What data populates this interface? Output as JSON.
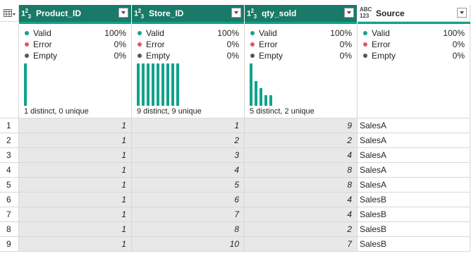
{
  "columns": [
    {
      "name": "Product_ID",
      "type_icon": "1²3",
      "profile": {
        "valid_label": "Valid",
        "valid_pct": "100%",
        "error_label": "Error",
        "error_pct": "0%",
        "empty_label": "Empty",
        "empty_pct": "0%",
        "distinct": "1 distinct, 0 unique",
        "histogram": [
          1.0
        ]
      }
    },
    {
      "name": "Store_ID",
      "type_icon": "1²3",
      "profile": {
        "valid_label": "Valid",
        "valid_pct": "100%",
        "error_label": "Error",
        "error_pct": "0%",
        "empty_label": "Empty",
        "empty_pct": "0%",
        "distinct": "9 distinct, 9 unique",
        "histogram": [
          1,
          1,
          1,
          1,
          1,
          1,
          1,
          1,
          1
        ]
      }
    },
    {
      "name": "qty_sold",
      "type_icon": "1²3",
      "profile": {
        "valid_label": "Valid",
        "valid_pct": "100%",
        "error_label": "Error",
        "error_pct": "0%",
        "empty_label": "Empty",
        "empty_pct": "0%",
        "distinct": "5 distinct, 2 unique",
        "histogram": [
          1.0,
          0.58,
          0.42,
          0.25,
          0.25
        ]
      }
    },
    {
      "name": "Source",
      "type_icon": "ABC 123",
      "profile": {
        "valid_label": "Valid",
        "valid_pct": "100%",
        "error_label": "Error",
        "error_pct": "0%",
        "empty_label": "Empty",
        "empty_pct": "0%",
        "distinct": "",
        "histogram": []
      }
    }
  ],
  "rows": [
    {
      "n": "1",
      "cells": [
        "1",
        "1",
        "9",
        "SalesA"
      ]
    },
    {
      "n": "2",
      "cells": [
        "1",
        "2",
        "2",
        "SalesA"
      ]
    },
    {
      "n": "3",
      "cells": [
        "1",
        "3",
        "4",
        "SalesA"
      ]
    },
    {
      "n": "4",
      "cells": [
        "1",
        "4",
        "8",
        "SalesA"
      ]
    },
    {
      "n": "5",
      "cells": [
        "1",
        "5",
        "8",
        "SalesA"
      ]
    },
    {
      "n": "6",
      "cells": [
        "1",
        "6",
        "4",
        "SalesB"
      ]
    },
    {
      "n": "7",
      "cells": [
        "1",
        "7",
        "4",
        "SalesB"
      ]
    },
    {
      "n": "8",
      "cells": [
        "1",
        "8",
        "2",
        "SalesB"
      ]
    },
    {
      "n": "9",
      "cells": [
        "1",
        "10",
        "7",
        "SalesB"
      ]
    }
  ],
  "colors": {
    "header_selected": "#1a7a68",
    "quality_bar": "#11a38a",
    "valid_dot": "#11a38a",
    "error_dot": "#e05a5a",
    "empty_dot": "#555555"
  },
  "icons": {
    "table_menu": "table-menu-icon",
    "dropdown": "chevron-down-icon"
  }
}
